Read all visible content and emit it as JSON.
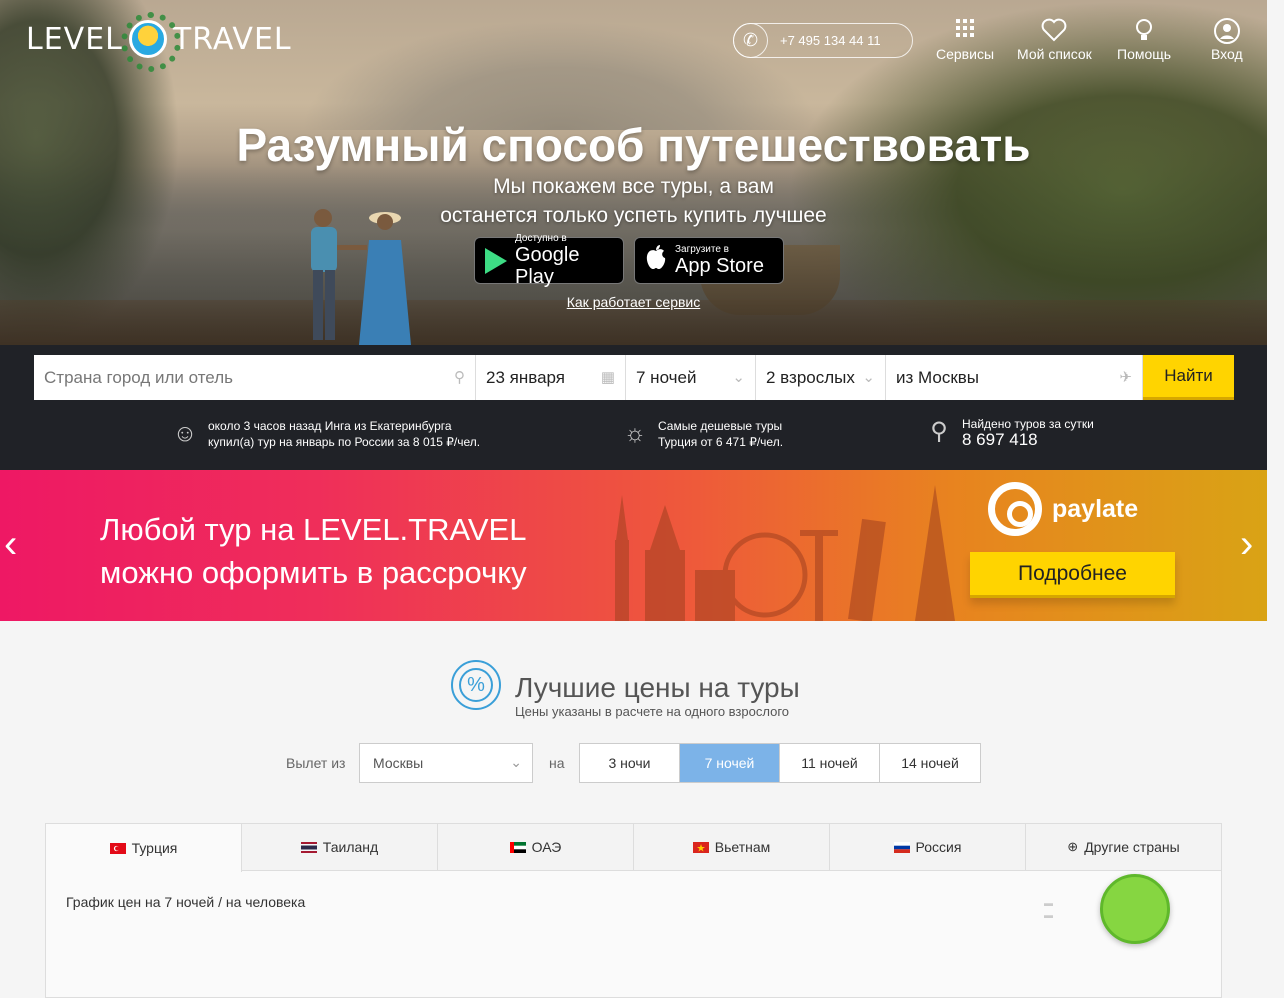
{
  "header": {
    "logo_left": "LEVEL",
    "logo_right": "TRAVEL",
    "phone": "+7 495 134 44 11",
    "nav": [
      {
        "label": "Сервисы",
        "icon": "grid-icon"
      },
      {
        "label": "Мой список",
        "icon": "heart-icon"
      },
      {
        "label": "Помощь",
        "icon": "lightbulb-icon"
      },
      {
        "label": "Вход",
        "icon": "user-icon"
      }
    ]
  },
  "hero": {
    "title": "Разумный способ путешествовать",
    "subtitle_line1": "Мы покажем все туры, а вам",
    "subtitle_line2": "останется только успеть купить лучшее",
    "google_small": "Доступно в",
    "google_big": "Google Play",
    "apple_small": "Загрузите в",
    "apple_big": "App Store",
    "how_link": "Как работает сервис"
  },
  "search": {
    "destination_placeholder": "Страна город или отель",
    "date": "23 января",
    "nights": "7 ночей",
    "adults": "2 взрослых",
    "from": "из Москвы",
    "find_button": "Найти"
  },
  "info": {
    "recent_line1": "около 3 часов назад Инга из Екатеринбурга",
    "recent_line2": "купил(а) тур на январь по России за 8 015 ₽/чел.",
    "cheap_line1": "Самые дешевые туры",
    "cheap_line2": "Турция от 6 471 ₽/чел.",
    "found_label": "Найдено туров за сутки",
    "found_count": "8 697 418"
  },
  "promo": {
    "line1": "Любой тур на LEVEL.TRAVEL",
    "line2": "можно оформить в рассрочку",
    "brand": "paylate",
    "button": "Подробнее",
    "arrow_left": "‹",
    "arrow_right": "›"
  },
  "best_prices": {
    "icon": "%",
    "title": "Лучшие цены на туры",
    "subtitle": "Цены указаны в расчете на одного взрослого",
    "from_label": "Вылет из",
    "from_value": "Москвы",
    "na_label": "на",
    "nights": [
      "3 ночи",
      "7 ночей",
      "11 ночей",
      "14 ночей"
    ],
    "active_nights": "7 ночей",
    "tabs": [
      "Турция",
      "Таиланд",
      "ОАЭ",
      "Вьетнам",
      "Россия",
      "Другие страны"
    ],
    "chart_label": "График цен на 7 ночей / на человека"
  },
  "colors": {
    "accent_yellow": "#ffd400",
    "active_tab_blue": "#7cb3e8",
    "dark_bar": "#202227"
  }
}
